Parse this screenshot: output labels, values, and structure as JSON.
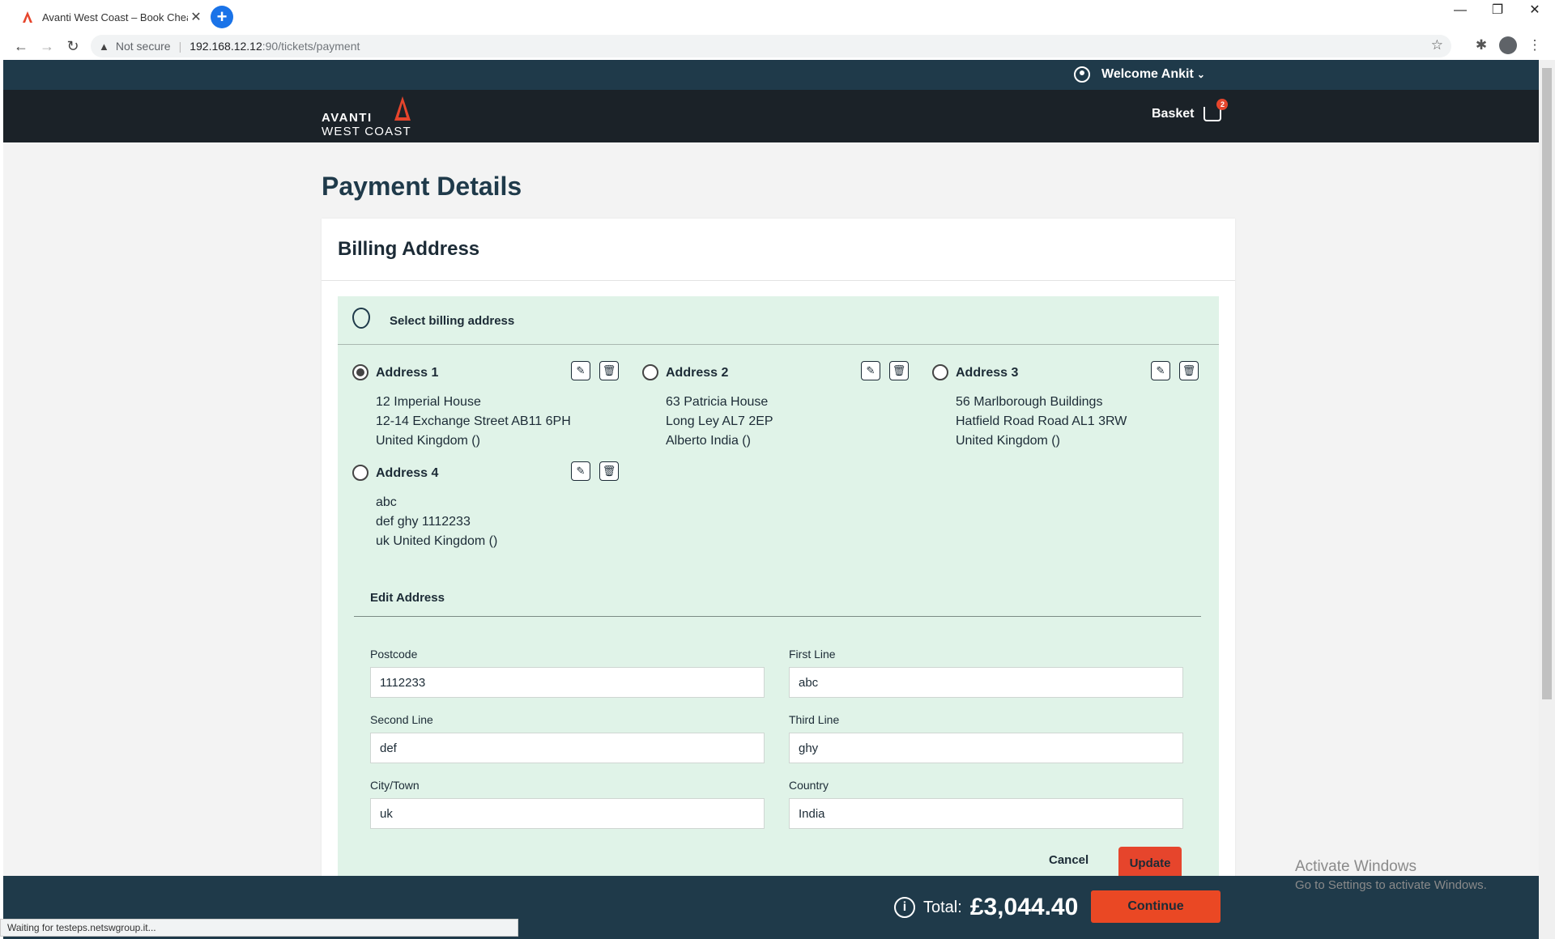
{
  "browser": {
    "tab_title": "Avanti West Coast – Book Cheap",
    "tab_close": "✕",
    "new_tab": "+",
    "security_label": "Not secure",
    "url_host": "192.168.12.12",
    "url_rest": ":90/tickets/payment",
    "status_text": "Waiting for testeps.netswgroup.it..."
  },
  "header": {
    "welcome": "Welcome Ankit",
    "logo_line1": "AVANTI",
    "logo_line2": "WEST COAST",
    "basket_label": "Basket",
    "basket_count": "2"
  },
  "page": {
    "title": "Payment Details",
    "section_title": "Billing Address",
    "select_label": "Select billing address"
  },
  "addresses": [
    {
      "name": "Address 1",
      "lines": [
        "12 Imperial House",
        "12-14 Exchange Street AB11 6PH",
        "United Kingdom ()"
      ],
      "selected": true
    },
    {
      "name": "Address 2",
      "lines": [
        "63 Patricia House",
        "Long Ley AL7 2EP",
        "Alberto India ()"
      ],
      "selected": false
    },
    {
      "name": "Address 3",
      "lines": [
        "56 Marlborough Buildings",
        "Hatfield Road Road AL1 3RW",
        "United Kingdom ()"
      ],
      "selected": false
    },
    {
      "name": "Address 4",
      "lines": [
        "abc",
        "def ghy 1112233",
        "uk United Kingdom ()"
      ],
      "selected": false
    }
  ],
  "edit": {
    "title": "Edit Address",
    "postcode_label": "Postcode",
    "postcode_value": "1112233",
    "first_line_label": "First Line",
    "first_line_value": "abc",
    "second_line_label": "Second Line",
    "second_line_value": "def",
    "third_line_label": "Third Line",
    "third_line_value": "ghy",
    "city_label": "City/Town",
    "city_value": "uk",
    "country_label": "Country",
    "country_value": "India",
    "cancel_label": "Cancel",
    "update_label": "Update"
  },
  "footer": {
    "total_label": "Total:",
    "total_value": "£3,044.40",
    "continue_label": "Continue"
  },
  "os": {
    "activate_line1": "Activate Windows",
    "activate_line2": "Go to Settings to activate Windows."
  },
  "colors": {
    "accent": "#e6452c",
    "navy": "#1f3a4a",
    "panel": "#e0f3e8"
  }
}
